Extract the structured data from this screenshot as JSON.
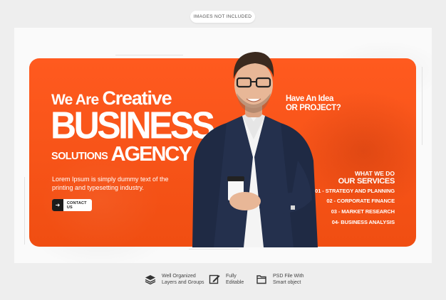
{
  "badge": "IMAGES NOT INCLUDED",
  "banner": {
    "headline_prefix": "We Are ",
    "headline_creative": "Creative",
    "headline_business": "BUSINESS",
    "headline_solutions": "SOLUTIONS",
    "headline_agency": "AGENCY",
    "description": "Lorem Ipsum is simply dummy text of the printing and typesetting industry.",
    "contact_label": "CONTACT US",
    "idea_line1": "Have An Idea",
    "idea_line2": "OR PROJECT?",
    "what_we_do": "WHAT WE DO",
    "our_services": "OUR SERVICES",
    "services": [
      "01 - STRATEGY AND PLANNING",
      "02 - CORPORATE FINANCE",
      "03 - MARKET RESEARCH",
      "04- BUSINESS ANALYSIS"
    ]
  },
  "features": [
    {
      "icon": "layers-icon",
      "line1": "Well Organized",
      "line2": "Layers and Groups"
    },
    {
      "icon": "edit-icon",
      "line1": "Fully",
      "line2": "Editable"
    },
    {
      "icon": "psd-file-icon",
      "line1": "PSD File With",
      "line2": "Smart object"
    }
  ],
  "colors": {
    "accent": "#f2511a",
    "background": "#eeeeee",
    "dark": "#1c1c1c"
  }
}
